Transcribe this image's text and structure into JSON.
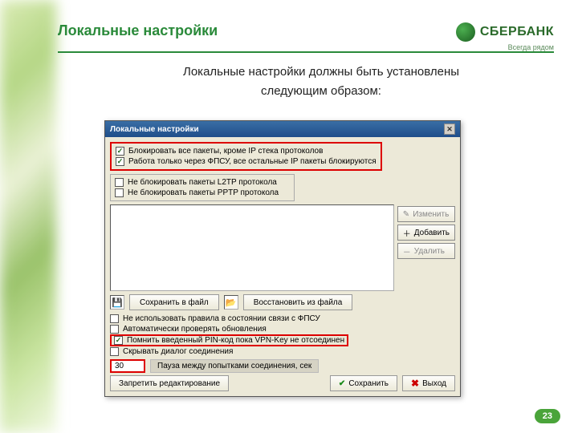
{
  "page": {
    "title": "Локальные настройки",
    "intro_line1": "Локальные настройки должны быть установлены",
    "intro_line2": "следующим образом:",
    "number": "23"
  },
  "brand": {
    "name": "СБЕРБАНК",
    "tagline": "Всегда рядом"
  },
  "dialog": {
    "title": "Локальные настройки",
    "top_checks": [
      {
        "label": "Блокировать все пакеты, кроме IP стека протоколов",
        "checked": true
      },
      {
        "label": "Работа только через ФПСУ, все остальные IP пакеты блокируются",
        "checked": true
      }
    ],
    "proto_checks": [
      {
        "label": "Не блокировать пакеты L2TP протокола",
        "checked": false
      },
      {
        "label": "Не блокировать пакеты PPTP протокола",
        "checked": false
      }
    ],
    "side_buttons": {
      "edit": "Изменить",
      "add": "Добавить",
      "delete": "Удалить"
    },
    "file_buttons": {
      "save_to_file": "Сохранить в файл",
      "restore_from_file": "Восстановить из файла"
    },
    "lower_checks": {
      "no_rules_fpsu": "Не использовать правила в состоянии связи с ФПСУ",
      "auto_check": "Автоматически проверять обновления",
      "remember_pin": "Помнить введенный PIN-код пока VPN-Key не отсоединен",
      "hide_conn": "Скрывать диалог соединения"
    },
    "pause": {
      "value": "30",
      "label": "Пауза между попытками соединения, сек"
    },
    "bottom": {
      "forbid_edit": "Запретить редактирование",
      "save": "Сохранить",
      "exit": "Выход"
    }
  }
}
